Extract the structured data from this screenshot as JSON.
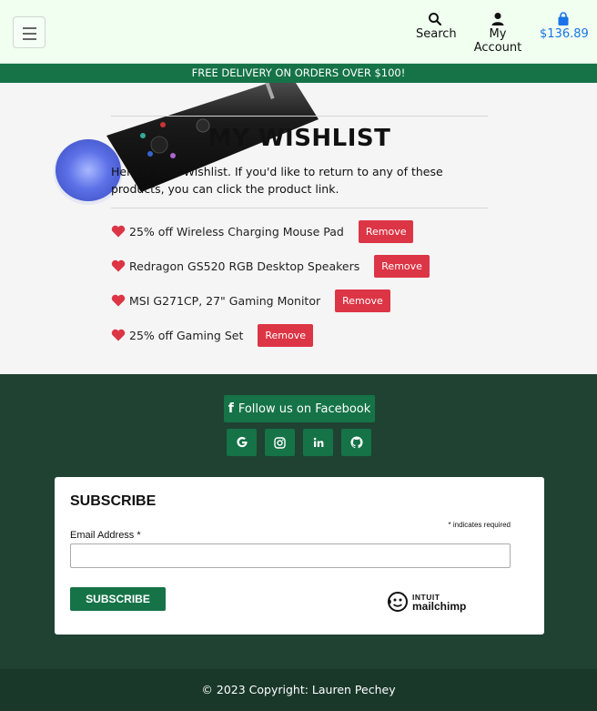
{
  "header": {
    "menu_icon": "hamburger-icon",
    "search_label": "Search",
    "account_label": "My Account",
    "cart_total": "$136.89"
  },
  "banner": {
    "text": "FREE DELIVERY ON ORDERS OVER $100!"
  },
  "wishlist": {
    "title": "MY WISHLIST",
    "intro": "Here is your Wishlist. If you'd like to return to any of these products, you can click the product link.",
    "remove_label": "Remove",
    "items": [
      {
        "name": "25% off Wireless Charging Mouse Pad"
      },
      {
        "name": "Redragon GS520 RGB Desktop Speakers"
      },
      {
        "name": "MSI G271CP, 27\" Gaming Monitor"
      },
      {
        "name": "25% off Gaming Set"
      }
    ]
  },
  "footer": {
    "facebook_label": "Follow us on Facebook",
    "social": [
      "google-icon",
      "instagram-icon",
      "linkedin-icon",
      "github-icon"
    ],
    "subscribe": {
      "title": "SUBSCRIBE",
      "required_note": "* indicates required",
      "email_label": "Email Address *",
      "email_value": "",
      "button_label": "SUBSCRIBE",
      "logo_line1": "INTUIT",
      "logo_line2": "mailchimp"
    },
    "copyright": "© 2023 Copyright: Lauren Pechey"
  },
  "colors": {
    "accent_green": "#157347",
    "footer_bg": "#1f4232",
    "remove_red": "#dc3545",
    "cart_blue": "#1a73e8"
  }
}
